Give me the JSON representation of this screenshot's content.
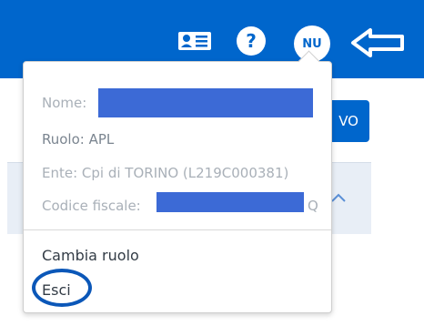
{
  "topbar": {
    "color": "#0066cc",
    "icons": [
      "id-card-icon",
      "help-icon",
      "back-arrow-icon"
    ],
    "avatar_initials": "NU"
  },
  "background": {
    "button_label": "VO"
  },
  "user_menu": {
    "name_label": "Nome:",
    "role_label": "Ruolo: APL",
    "ente_label": "Ente: Cpi di TORINO (L219C000381)",
    "cf_label": "Codice fiscale:",
    "cf_suffix": "Q",
    "actions": {
      "change_role": "Cambia ruolo",
      "logout": "Esci"
    },
    "highlight_color": "#0b57b8"
  }
}
